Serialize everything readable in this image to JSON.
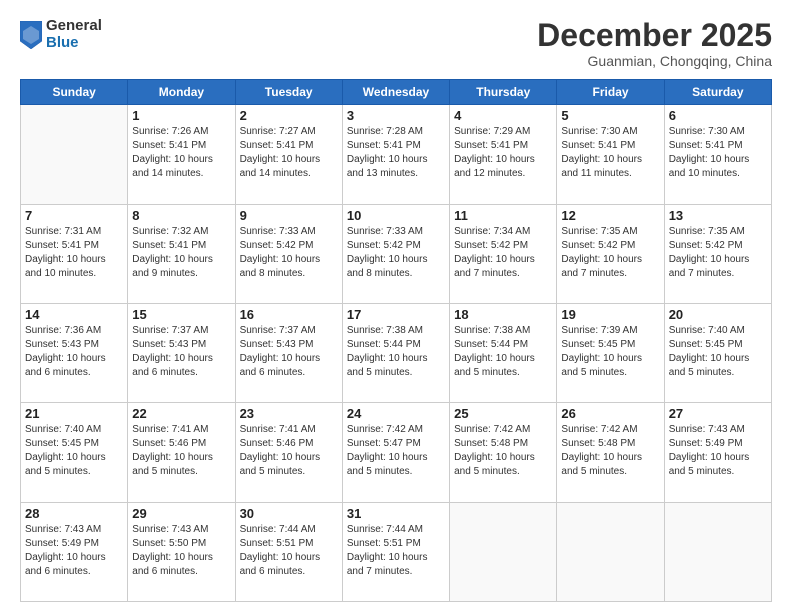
{
  "header": {
    "logo_general": "General",
    "logo_blue": "Blue",
    "month_title": "December 2025",
    "subtitle": "Guanmian, Chongqing, China"
  },
  "weekdays": [
    "Sunday",
    "Monday",
    "Tuesday",
    "Wednesday",
    "Thursday",
    "Friday",
    "Saturday"
  ],
  "weeks": [
    [
      {
        "day": "",
        "sunrise": "",
        "sunset": "",
        "daylight": ""
      },
      {
        "day": "1",
        "sunrise": "Sunrise: 7:26 AM",
        "sunset": "Sunset: 5:41 PM",
        "daylight": "Daylight: 10 hours and 14 minutes."
      },
      {
        "day": "2",
        "sunrise": "Sunrise: 7:27 AM",
        "sunset": "Sunset: 5:41 PM",
        "daylight": "Daylight: 10 hours and 14 minutes."
      },
      {
        "day": "3",
        "sunrise": "Sunrise: 7:28 AM",
        "sunset": "Sunset: 5:41 PM",
        "daylight": "Daylight: 10 hours and 13 minutes."
      },
      {
        "day": "4",
        "sunrise": "Sunrise: 7:29 AM",
        "sunset": "Sunset: 5:41 PM",
        "daylight": "Daylight: 10 hours and 12 minutes."
      },
      {
        "day": "5",
        "sunrise": "Sunrise: 7:30 AM",
        "sunset": "Sunset: 5:41 PM",
        "daylight": "Daylight: 10 hours and 11 minutes."
      },
      {
        "day": "6",
        "sunrise": "Sunrise: 7:30 AM",
        "sunset": "Sunset: 5:41 PM",
        "daylight": "Daylight: 10 hours and 10 minutes."
      }
    ],
    [
      {
        "day": "7",
        "sunrise": "Sunrise: 7:31 AM",
        "sunset": "Sunset: 5:41 PM",
        "daylight": "Daylight: 10 hours and 10 minutes."
      },
      {
        "day": "8",
        "sunrise": "Sunrise: 7:32 AM",
        "sunset": "Sunset: 5:41 PM",
        "daylight": "Daylight: 10 hours and 9 minutes."
      },
      {
        "day": "9",
        "sunrise": "Sunrise: 7:33 AM",
        "sunset": "Sunset: 5:42 PM",
        "daylight": "Daylight: 10 hours and 8 minutes."
      },
      {
        "day": "10",
        "sunrise": "Sunrise: 7:33 AM",
        "sunset": "Sunset: 5:42 PM",
        "daylight": "Daylight: 10 hours and 8 minutes."
      },
      {
        "day": "11",
        "sunrise": "Sunrise: 7:34 AM",
        "sunset": "Sunset: 5:42 PM",
        "daylight": "Daylight: 10 hours and 7 minutes."
      },
      {
        "day": "12",
        "sunrise": "Sunrise: 7:35 AM",
        "sunset": "Sunset: 5:42 PM",
        "daylight": "Daylight: 10 hours and 7 minutes."
      },
      {
        "day": "13",
        "sunrise": "Sunrise: 7:35 AM",
        "sunset": "Sunset: 5:42 PM",
        "daylight": "Daylight: 10 hours and 7 minutes."
      }
    ],
    [
      {
        "day": "14",
        "sunrise": "Sunrise: 7:36 AM",
        "sunset": "Sunset: 5:43 PM",
        "daylight": "Daylight: 10 hours and 6 minutes."
      },
      {
        "day": "15",
        "sunrise": "Sunrise: 7:37 AM",
        "sunset": "Sunset: 5:43 PM",
        "daylight": "Daylight: 10 hours and 6 minutes."
      },
      {
        "day": "16",
        "sunrise": "Sunrise: 7:37 AM",
        "sunset": "Sunset: 5:43 PM",
        "daylight": "Daylight: 10 hours and 6 minutes."
      },
      {
        "day": "17",
        "sunrise": "Sunrise: 7:38 AM",
        "sunset": "Sunset: 5:44 PM",
        "daylight": "Daylight: 10 hours and 5 minutes."
      },
      {
        "day": "18",
        "sunrise": "Sunrise: 7:38 AM",
        "sunset": "Sunset: 5:44 PM",
        "daylight": "Daylight: 10 hours and 5 minutes."
      },
      {
        "day": "19",
        "sunrise": "Sunrise: 7:39 AM",
        "sunset": "Sunset: 5:45 PM",
        "daylight": "Daylight: 10 hours and 5 minutes."
      },
      {
        "day": "20",
        "sunrise": "Sunrise: 7:40 AM",
        "sunset": "Sunset: 5:45 PM",
        "daylight": "Daylight: 10 hours and 5 minutes."
      }
    ],
    [
      {
        "day": "21",
        "sunrise": "Sunrise: 7:40 AM",
        "sunset": "Sunset: 5:45 PM",
        "daylight": "Daylight: 10 hours and 5 minutes."
      },
      {
        "day": "22",
        "sunrise": "Sunrise: 7:41 AM",
        "sunset": "Sunset: 5:46 PM",
        "daylight": "Daylight: 10 hours and 5 minutes."
      },
      {
        "day": "23",
        "sunrise": "Sunrise: 7:41 AM",
        "sunset": "Sunset: 5:46 PM",
        "daylight": "Daylight: 10 hours and 5 minutes."
      },
      {
        "day": "24",
        "sunrise": "Sunrise: 7:42 AM",
        "sunset": "Sunset: 5:47 PM",
        "daylight": "Daylight: 10 hours and 5 minutes."
      },
      {
        "day": "25",
        "sunrise": "Sunrise: 7:42 AM",
        "sunset": "Sunset: 5:48 PM",
        "daylight": "Daylight: 10 hours and 5 minutes."
      },
      {
        "day": "26",
        "sunrise": "Sunrise: 7:42 AM",
        "sunset": "Sunset: 5:48 PM",
        "daylight": "Daylight: 10 hours and 5 minutes."
      },
      {
        "day": "27",
        "sunrise": "Sunrise: 7:43 AM",
        "sunset": "Sunset: 5:49 PM",
        "daylight": "Daylight: 10 hours and 5 minutes."
      }
    ],
    [
      {
        "day": "28",
        "sunrise": "Sunrise: 7:43 AM",
        "sunset": "Sunset: 5:49 PM",
        "daylight": "Daylight: 10 hours and 6 minutes."
      },
      {
        "day": "29",
        "sunrise": "Sunrise: 7:43 AM",
        "sunset": "Sunset: 5:50 PM",
        "daylight": "Daylight: 10 hours and 6 minutes."
      },
      {
        "day": "30",
        "sunrise": "Sunrise: 7:44 AM",
        "sunset": "Sunset: 5:51 PM",
        "daylight": "Daylight: 10 hours and 6 minutes."
      },
      {
        "day": "31",
        "sunrise": "Sunrise: 7:44 AM",
        "sunset": "Sunset: 5:51 PM",
        "daylight": "Daylight: 10 hours and 7 minutes."
      },
      {
        "day": "",
        "sunrise": "",
        "sunset": "",
        "daylight": ""
      },
      {
        "day": "",
        "sunrise": "",
        "sunset": "",
        "daylight": ""
      },
      {
        "day": "",
        "sunrise": "",
        "sunset": "",
        "daylight": ""
      }
    ]
  ]
}
